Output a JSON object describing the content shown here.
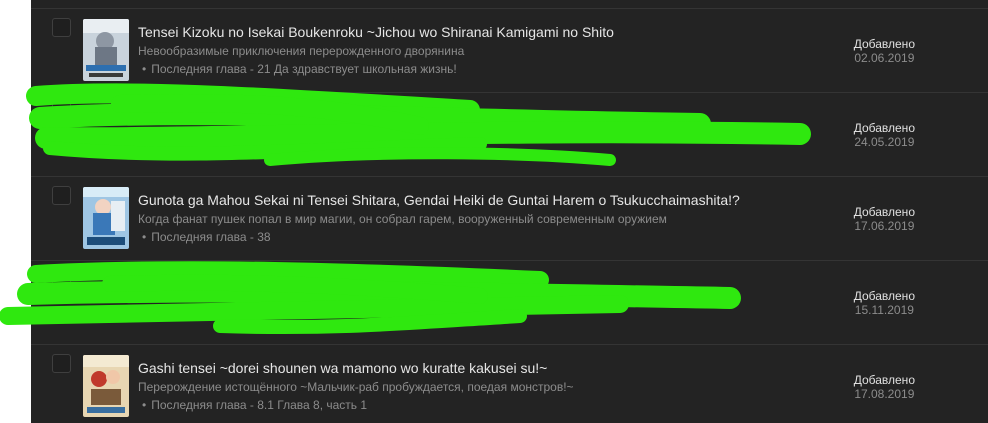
{
  "added_label": "Добавлено",
  "chapter_prefix": "Последняя глава - ",
  "bullet": "•",
  "entries": [
    {
      "title": "Tensei Kizoku no Isekai Boukenroku ~Jichou wo Shiranai Kamigami no Shito",
      "subtitle": "Невообразимые приключения перерожденного дворянина",
      "chapter": "21 Да здравствует школьная жизнь!",
      "date": "02.06.2019"
    },
    {
      "title": "",
      "subtitle": "",
      "chapter": "",
      "date": "24.05.2019",
      "redacted": true
    },
    {
      "title": "Gunota ga Mahou Sekai ni Tensei Shitara, Gendai Heiki de Guntai Harem o Tsukucchaimashita!?",
      "subtitle": "Когда фанат пушек попал в мир магии, он собрал гарем, вооруженный современным оружием",
      "chapter": "38",
      "date": "17.06.2019"
    },
    {
      "title": "",
      "subtitle": "",
      "chapter": "",
      "date": "15.11.2019",
      "redacted": true
    },
    {
      "title": "Gashi tensei ~dorei shounen wa mamono wo kuratte kakusei su!~",
      "subtitle": "Перерождение истощённого ~Мальчик-раб пробуждается, поедая монстров!~",
      "chapter": "8.1 Глава 8, часть 1",
      "date": "17.08.2019"
    }
  ],
  "colors": {
    "panel_bg": "#232323",
    "title": "#e6e6e6",
    "muted": "#8c8c8c",
    "redaction": "#2fe80f"
  }
}
